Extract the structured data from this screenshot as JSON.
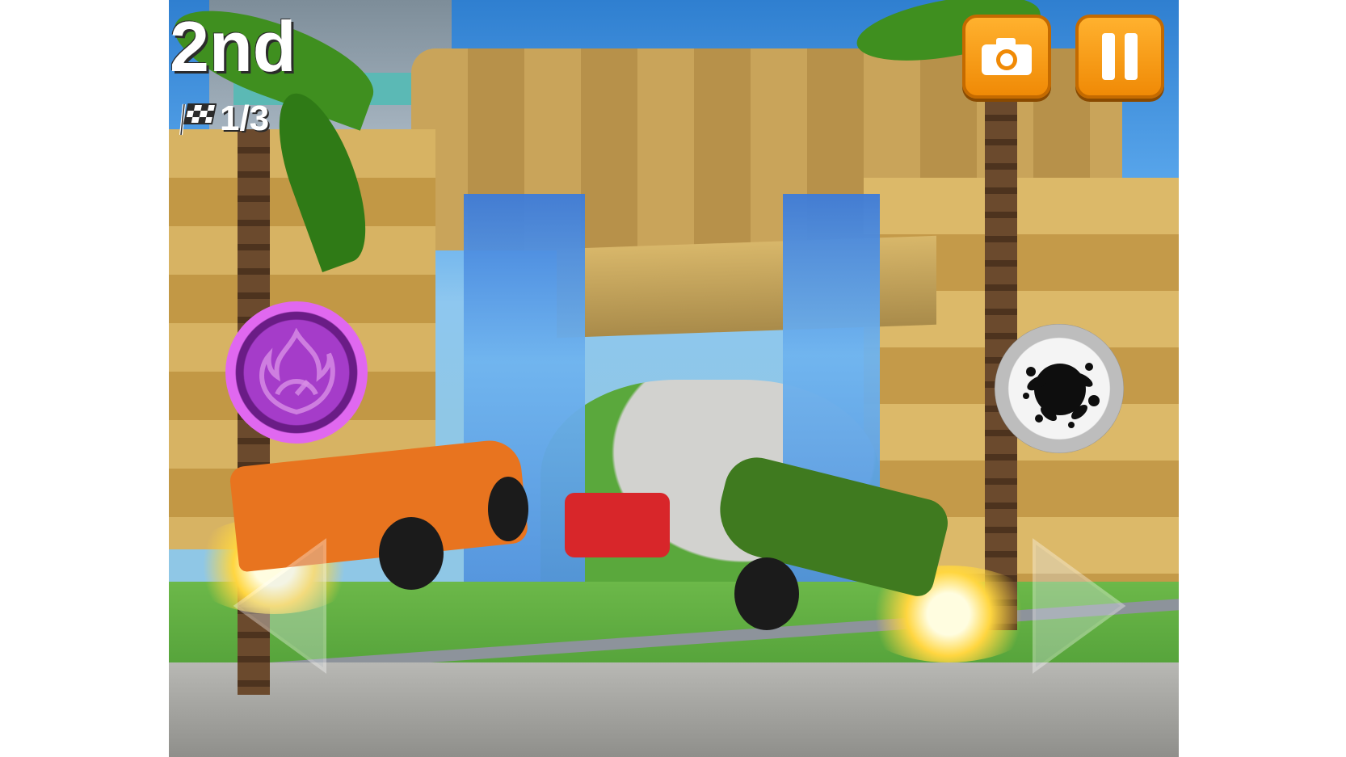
{
  "hud": {
    "position": "2nd",
    "lap": "1/3"
  },
  "icons": {
    "lap_flag": "checkered-flag-icon",
    "camera": "camera-icon",
    "pause": "pause-icon",
    "powerup": "nitro-boost-icon",
    "weapon": "oil-slick-icon",
    "steer_left": "steer-left-arrow-icon",
    "steer_right": "steer-right-arrow-icon"
  },
  "colors": {
    "button_orange": "#f59a12",
    "powerup_purple": "#a53cc9",
    "hud_text": "#ffffff"
  }
}
